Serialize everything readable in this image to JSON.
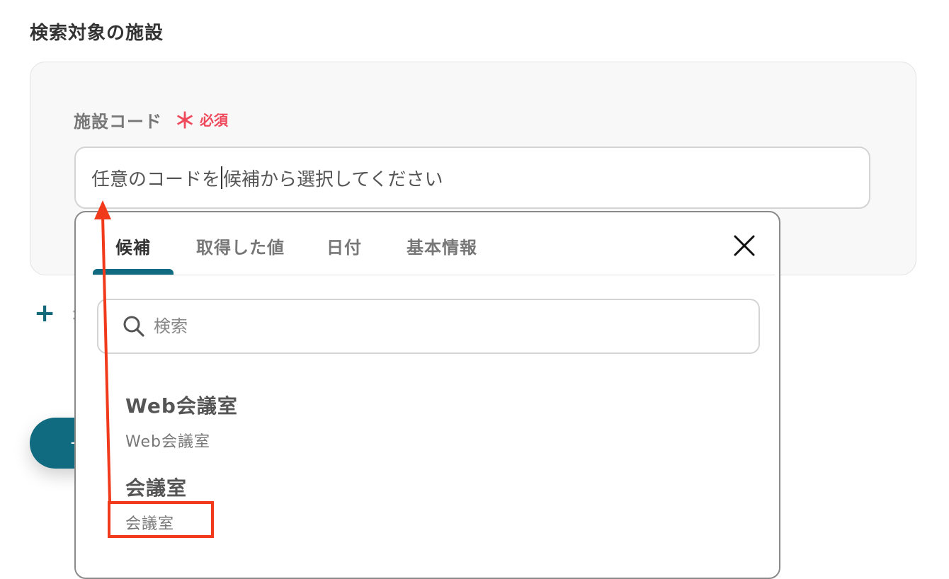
{
  "section": {
    "title": "検索対象の施設"
  },
  "field": {
    "label": "施設コード",
    "required_mark": "＊",
    "required_label": "必須",
    "value_before_caret": "任意のコードを",
    "value_after_caret": "候補から選択してください"
  },
  "add_row": {
    "icon": "plus-icon",
    "label": "："
  },
  "primary_button": {
    "label": "+"
  },
  "dropdown": {
    "tabs": [
      {
        "label": "候補",
        "active": true
      },
      {
        "label": "取得した値",
        "active": false
      },
      {
        "label": "日付",
        "active": false
      },
      {
        "label": "基本情報",
        "active": false
      }
    ],
    "close_icon": "close-icon",
    "search": {
      "icon": "search-icon",
      "placeholder": "検索"
    },
    "options": [
      {
        "title": "Web会議室",
        "subtitle": "Web会議室"
      },
      {
        "title": "会議室",
        "subtitle": "会議室"
      }
    ]
  },
  "colors": {
    "accent": "#116b80",
    "required": "#ef4a5c",
    "annotation": "#f13a1b"
  }
}
